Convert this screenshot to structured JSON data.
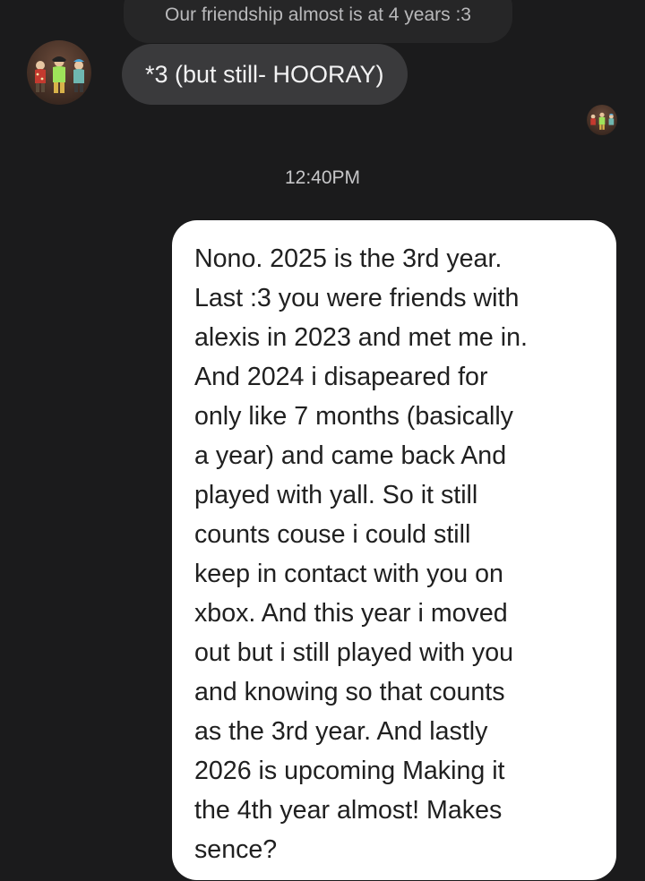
{
  "quoted_message": {
    "text": "Our friendship almost is at 4 years :3"
  },
  "incoming_message": {
    "text": "*3 (but still- HOORAY)"
  },
  "timestamp": "12:40PM",
  "outgoing_message": {
    "lines": [
      "Nono. 2025 is the 3rd year.",
      "Last :3 you were friends with",
      "alexis in 2023 and met me in.",
      "And 2024 i disapeared for",
      "only like 7 months (basically",
      "a year) and came back And",
      "played with yall. So it still",
      "counts couse i could still",
      "keep in contact with you on",
      "xbox. And this year i moved",
      "out but i still played with you",
      "and knowing so that counts",
      "as the 3rd year. And lastly",
      "2026 is upcoming Making it",
      "the 4th year almost! Makes",
      "sence?"
    ]
  }
}
